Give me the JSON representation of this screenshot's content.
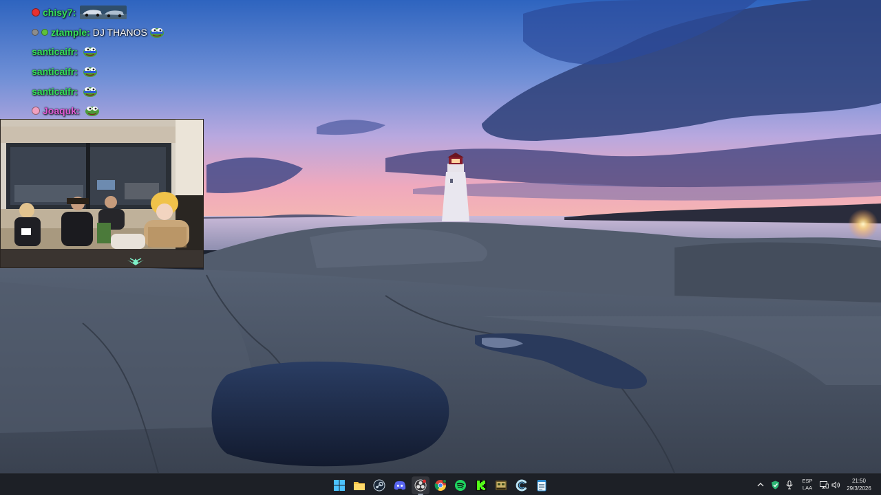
{
  "colors": {
    "taskbar_bg": "#1d2026",
    "chat_text": "#ffffff",
    "sky_top": "#2c62b8",
    "sky_horizon": "#f0a6b8",
    "rock": "#4a5563",
    "water": "#1d2a44"
  },
  "chat": {
    "messages": [
      {
        "badges": [
          "red-dot-badge"
        ],
        "username": "chisy7:",
        "username_color": "#35e05a",
        "text": "",
        "emote": "car-emote"
      },
      {
        "badges": [
          "gray-badge",
          "frog-badge"
        ],
        "username": "ztample:",
        "username_color": "#35e05a",
        "text": "DJ THANOS",
        "emote": "pepe-emote"
      },
      {
        "badges": [],
        "username": "santicaifr:",
        "username_color": "#35e05a",
        "text": "",
        "emote": "pepe-emote"
      },
      {
        "badges": [],
        "username": "santicaifr:",
        "username_color": "#35e05a",
        "text": "",
        "emote": "pepe-emote"
      },
      {
        "badges": [],
        "username": "santicaifr:",
        "username_color": "#35e05a",
        "text": "",
        "emote": "pepe-emote"
      },
      {
        "badges": [
          "pink-badge"
        ],
        "username": "Joaquk:",
        "username_color": "#e25bd6",
        "text": "",
        "emote": "pepe-emote"
      }
    ]
  },
  "webcam": {
    "scene": "four people sitting on a couch in front of a window"
  },
  "taskbar": {
    "pinned": [
      {
        "name": "windows-start-icon",
        "active": false
      },
      {
        "name": "file-explorer-icon",
        "active": false
      },
      {
        "name": "steam-icon",
        "active": false
      },
      {
        "name": "discord-icon",
        "active": false
      },
      {
        "name": "obs-icon",
        "active": true
      },
      {
        "name": "chrome-icon",
        "active": false
      },
      {
        "name": "spotify-icon",
        "active": false
      },
      {
        "name": "kick-icon",
        "active": false
      },
      {
        "name": "game-icon",
        "active": false
      },
      {
        "name": "c-app-icon",
        "active": false
      },
      {
        "name": "notepad-icon",
        "active": false
      }
    ],
    "tray": {
      "lang_line1": "ESP",
      "lang_line2": "LAA",
      "time": "21:50",
      "date": "29/3/2026"
    }
  }
}
